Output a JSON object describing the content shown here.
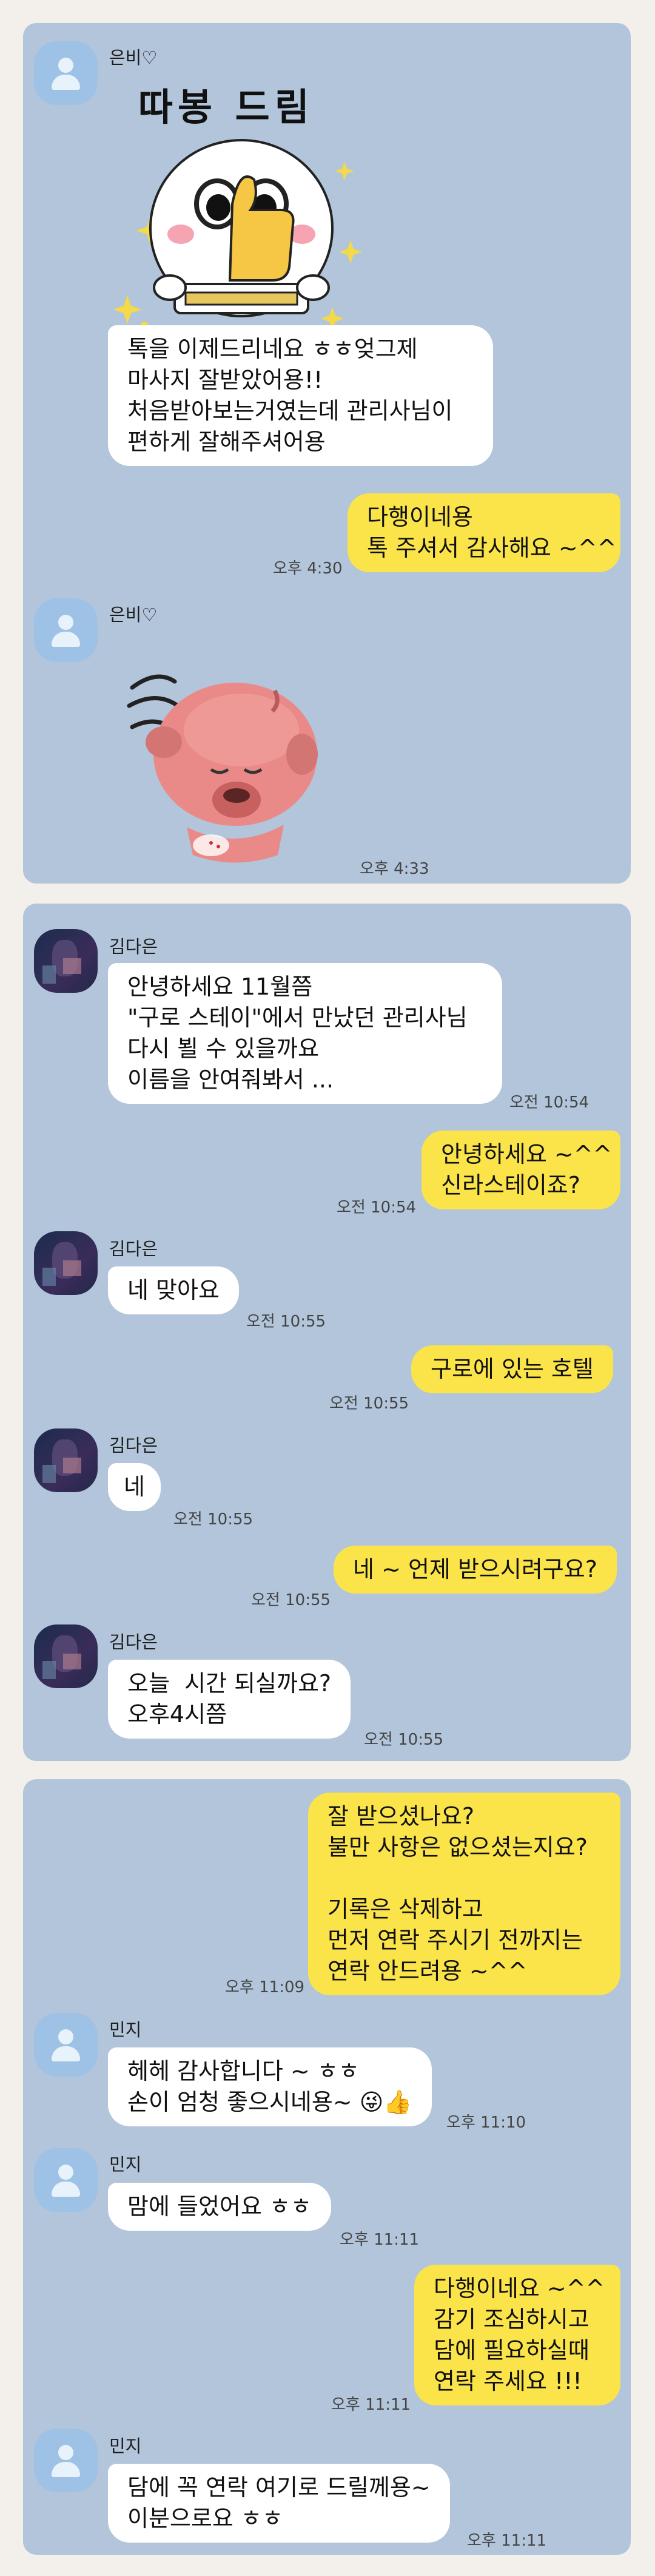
{
  "panel1": {
    "sender1": "은비♡",
    "sticker1_text": "따봉 드림",
    "msg1": "톡을 이제드리네요 ㅎㅎ엊그제\n마사지 잘받았어용!!\n처음받아보는거였는데 관리사님이\n편하게 잘해주셔어용",
    "reply1": "다행이네용\n톡 주셔서 감사해요 ~^^",
    "reply1_time": "오후 4:30",
    "sender2": "은비♡",
    "sticker2_time": "오후 4:33"
  },
  "panel2": {
    "sender": "김다은",
    "msg1": "안녕하세요 11월쯤\n\"구로 스테이\"에서 만났던 관리사님\n다시 뵐 수 있을까요\n이름을 안여줘봐서 ...",
    "msg1_time": "오전 10:54",
    "reply1": "안녕하세요 ~^^\n신라스테이죠?",
    "reply1_time": "오전 10:54",
    "msg2": "네 맞아요",
    "msg2_time": "오전 10:55",
    "reply2": "구로에 있는 호텔",
    "reply2_time": "오전 10:55",
    "msg3": "네",
    "msg3_time": "오전 10:55",
    "reply3": "네 ~ 언제 받으시려구요?",
    "reply3_time": "오전 10:55",
    "msg4": "오늘  시간 되실까요?\n오후4시쯤",
    "msg4_time": "오전 10:55"
  },
  "panel3": {
    "out1": "잘 받으셨나요?\n불만 사항은 없으셨는지요?\n\n기록은 삭제하고\n먼저 연락 주시기 전까지는\n연락 안드려용 ~^^",
    "out1_time": "오후 11:09",
    "sender": "민지",
    "msg1": "헤헤 감사합니다 ~ ㅎㅎ\n손이 엄청 좋으시네용~ 😜👍",
    "msg1_time": "오후 11:10",
    "msg2": "맘에 들었어요 ㅎㅎ",
    "msg2_time": "오후 11:11",
    "out2": "다행이네요 ~^^\n감기 조심하시고\n담에 필요하실때\n연락 주세요 !!!",
    "out2_time": "오후 11:11",
    "msg3": "담에 꼭 연락 여기로 드릴께용~\n이분으로요 ㅎㅎ",
    "msg3_time": "오후 11:11"
  },
  "colors": {
    "chat_bg": "#b2c5da",
    "outgoing_bubble": "#fbe44a",
    "incoming_bubble": "#ffffff",
    "page_bg": "#f3efea"
  },
  "icons": [
    "default-profile-icon",
    "blurred-profile-photo",
    "thumbs-up-sticker",
    "pink-character-sticker"
  ]
}
